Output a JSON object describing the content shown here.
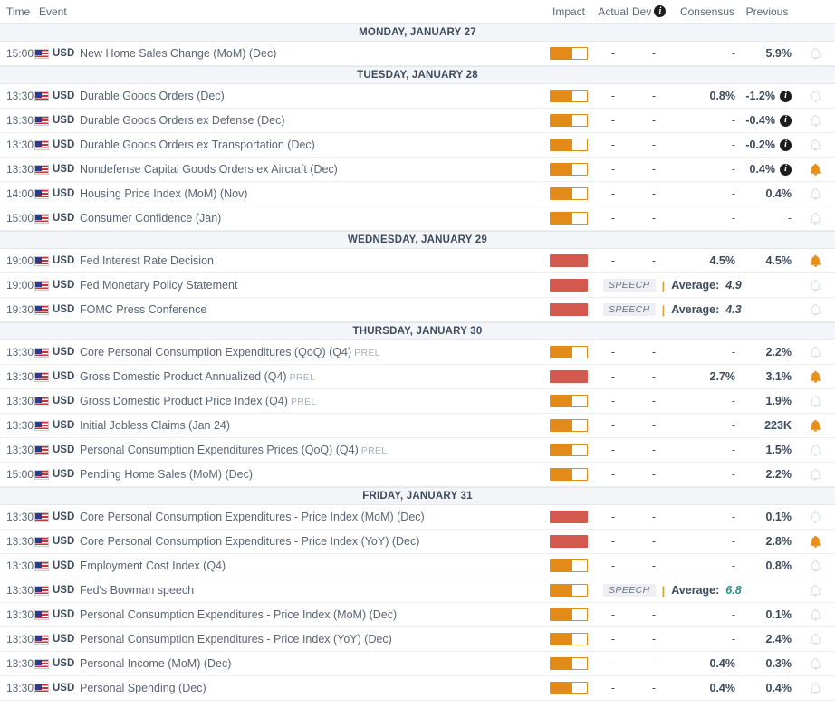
{
  "columns": {
    "time": "Time",
    "event": "Event",
    "impact": "Impact",
    "actual": "Actual",
    "dev": "Dev",
    "dev_info_icon": "info-icon",
    "consensus": "Consensus",
    "previous": "Previous"
  },
  "colors": {
    "impact_medium": "#e28b18",
    "impact_high": "#d3584e",
    "bell_active": "#e8901a",
    "bell_inactive": "#d8dce3",
    "day_header_bg": "#f4f5f8",
    "text": "#3d4a5c",
    "muted": "#5a6474",
    "tag": "#a8aeba",
    "speech_value_teal": "#2e8f86"
  },
  "days": [
    {
      "label": "MONDAY, JANUARY 27",
      "events": [
        {
          "time": "15:00",
          "currency": "USD",
          "flag": "us-flag-icon",
          "name": "New Home Sales Change (MoM) (Dec)",
          "tag": "",
          "impact": "medium",
          "actual": "-",
          "dev": "-",
          "consensus": "-",
          "consensus_bold": false,
          "previous": "5.9%",
          "previous_bold": true,
          "info": false,
          "bell": "inactive",
          "type": "data"
        }
      ]
    },
    {
      "label": "TUESDAY, JANUARY 28",
      "events": [
        {
          "time": "13:30",
          "currency": "USD",
          "flag": "us-flag-icon",
          "name": "Durable Goods Orders (Dec)",
          "tag": "",
          "impact": "medium",
          "actual": "-",
          "dev": "-",
          "consensus": "0.8%",
          "consensus_bold": true,
          "previous": "-1.2%",
          "previous_bold": true,
          "info": true,
          "bell": "inactive",
          "type": "data"
        },
        {
          "time": "13:30",
          "currency": "USD",
          "flag": "us-flag-icon",
          "name": "Durable Goods Orders ex Defense (Dec)",
          "tag": "",
          "impact": "medium",
          "actual": "-",
          "dev": "-",
          "consensus": "-",
          "consensus_bold": false,
          "previous": "-0.4%",
          "previous_bold": true,
          "info": true,
          "bell": "inactive",
          "type": "data"
        },
        {
          "time": "13:30",
          "currency": "USD",
          "flag": "us-flag-icon",
          "name": "Durable Goods Orders ex Transportation (Dec)",
          "tag": "",
          "impact": "medium",
          "actual": "-",
          "dev": "-",
          "consensus": "-",
          "consensus_bold": false,
          "previous": "-0.2%",
          "previous_bold": true,
          "info": true,
          "bell": "inactive",
          "type": "data"
        },
        {
          "time": "13:30",
          "currency": "USD",
          "flag": "us-flag-icon",
          "name": "Nondefense Capital Goods Orders ex Aircraft (Dec)",
          "tag": "",
          "impact": "medium",
          "actual": "-",
          "dev": "-",
          "consensus": "-",
          "consensus_bold": false,
          "previous": "0.4%",
          "previous_bold": true,
          "info": true,
          "bell": "active",
          "type": "data"
        },
        {
          "time": "14:00",
          "currency": "USD",
          "flag": "us-flag-icon",
          "name": "Housing Price Index (MoM) (Nov)",
          "tag": "",
          "impact": "medium",
          "actual": "-",
          "dev": "-",
          "consensus": "-",
          "consensus_bold": false,
          "previous": "0.4%",
          "previous_bold": true,
          "info": false,
          "bell": "inactive",
          "type": "data"
        },
        {
          "time": "15:00",
          "currency": "USD",
          "flag": "us-flag-icon",
          "name": "Consumer Confidence (Jan)",
          "tag": "",
          "impact": "medium",
          "actual": "-",
          "dev": "-",
          "consensus": "-",
          "consensus_bold": false,
          "previous": "-",
          "previous_bold": false,
          "info": false,
          "bell": "inactive",
          "type": "data"
        }
      ]
    },
    {
      "label": "WEDNESDAY, JANUARY 29",
      "events": [
        {
          "time": "19:00",
          "currency": "USD",
          "flag": "us-flag-icon",
          "name": "Fed Interest Rate Decision",
          "tag": "",
          "impact": "high",
          "actual": "-",
          "dev": "-",
          "consensus": "4.5%",
          "consensus_bold": true,
          "previous": "4.5%",
          "previous_bold": true,
          "info": false,
          "bell": "active",
          "type": "data"
        },
        {
          "time": "19:00",
          "currency": "USD",
          "flag": "us-flag-icon",
          "name": "Fed Monetary Policy Statement",
          "tag": "",
          "impact": "high",
          "speech_badge": "SPEECH",
          "speech_label": "Average:",
          "speech_value": "4.9",
          "speech_value_teal": false,
          "bell": "inactive",
          "type": "speech"
        },
        {
          "time": "19:30",
          "currency": "USD",
          "flag": "us-flag-icon",
          "name": "FOMC Press Conference",
          "tag": "",
          "impact": "high",
          "speech_badge": "SPEECH",
          "speech_label": "Average:",
          "speech_value": "4.3",
          "speech_value_teal": false,
          "bell": "inactive",
          "type": "speech"
        }
      ]
    },
    {
      "label": "THURSDAY, JANUARY 30",
      "events": [
        {
          "time": "13:30",
          "currency": "USD",
          "flag": "us-flag-icon",
          "name": "Core Personal Consumption Expenditures (QoQ) (Q4)",
          "tag": "PREL",
          "impact": "medium",
          "actual": "-",
          "dev": "-",
          "consensus": "-",
          "consensus_bold": false,
          "previous": "2.2%",
          "previous_bold": true,
          "info": false,
          "bell": "inactive",
          "type": "data"
        },
        {
          "time": "13:30",
          "currency": "USD",
          "flag": "us-flag-icon",
          "name": "Gross Domestic Product Annualized (Q4)",
          "tag": "PREL",
          "impact": "high",
          "actual": "-",
          "dev": "-",
          "consensus": "2.7%",
          "consensus_bold": true,
          "previous": "3.1%",
          "previous_bold": true,
          "info": false,
          "bell": "active",
          "type": "data"
        },
        {
          "time": "13:30",
          "currency": "USD",
          "flag": "us-flag-icon",
          "name": "Gross Domestic Product Price Index (Q4)",
          "tag": "PREL",
          "impact": "medium",
          "actual": "-",
          "dev": "-",
          "consensus": "-",
          "consensus_bold": false,
          "previous": "1.9%",
          "previous_bold": true,
          "info": false,
          "bell": "inactive",
          "type": "data"
        },
        {
          "time": "13:30",
          "currency": "USD",
          "flag": "us-flag-icon",
          "name": "Initial Jobless Claims (Jan 24)",
          "tag": "",
          "impact": "medium",
          "actual": "-",
          "dev": "-",
          "consensus": "-",
          "consensus_bold": false,
          "previous": "223K",
          "previous_bold": true,
          "info": false,
          "bell": "active",
          "type": "data"
        },
        {
          "time": "13:30",
          "currency": "USD",
          "flag": "us-flag-icon",
          "name": "Personal Consumption Expenditures Prices (QoQ) (Q4)",
          "tag": "PREL",
          "impact": "medium",
          "actual": "-",
          "dev": "-",
          "consensus": "-",
          "consensus_bold": false,
          "previous": "1.5%",
          "previous_bold": true,
          "info": false,
          "bell": "inactive",
          "type": "data"
        },
        {
          "time": "15:00",
          "currency": "USD",
          "flag": "us-flag-icon",
          "name": "Pending Home Sales (MoM) (Dec)",
          "tag": "",
          "impact": "medium",
          "actual": "-",
          "dev": "-",
          "consensus": "-",
          "consensus_bold": false,
          "previous": "2.2%",
          "previous_bold": true,
          "info": false,
          "bell": "inactive",
          "type": "data"
        }
      ]
    },
    {
      "label": "FRIDAY, JANUARY 31",
      "events": [
        {
          "time": "13:30",
          "currency": "USD",
          "flag": "us-flag-icon",
          "name": "Core Personal Consumption Expenditures - Price Index (MoM) (Dec)",
          "tag": "",
          "impact": "high",
          "actual": "-",
          "dev": "-",
          "consensus": "-",
          "consensus_bold": false,
          "previous": "0.1%",
          "previous_bold": true,
          "info": false,
          "bell": "inactive",
          "type": "data"
        },
        {
          "time": "13:30",
          "currency": "USD",
          "flag": "us-flag-icon",
          "name": "Core Personal Consumption Expenditures - Price Index (YoY) (Dec)",
          "tag": "",
          "impact": "high",
          "actual": "-",
          "dev": "-",
          "consensus": "-",
          "consensus_bold": false,
          "previous": "2.8%",
          "previous_bold": true,
          "info": false,
          "bell": "active",
          "type": "data"
        },
        {
          "time": "13:30",
          "currency": "USD",
          "flag": "us-flag-icon",
          "name": "Employment Cost Index (Q4)",
          "tag": "",
          "impact": "medium",
          "actual": "-",
          "dev": "-",
          "consensus": "-",
          "consensus_bold": false,
          "previous": "0.8%",
          "previous_bold": true,
          "info": false,
          "bell": "inactive",
          "type": "data"
        },
        {
          "time": "13:30",
          "currency": "USD",
          "flag": "us-flag-icon",
          "name": "Fed's Bowman speech",
          "tag": "",
          "impact": "medium",
          "speech_badge": "SPEECH",
          "speech_label": "Average:",
          "speech_value": "6.8",
          "speech_value_teal": true,
          "bell": "inactive",
          "type": "speech"
        },
        {
          "time": "13:30",
          "currency": "USD",
          "flag": "us-flag-icon",
          "name": "Personal Consumption Expenditures - Price Index (MoM) (Dec)",
          "tag": "",
          "impact": "medium",
          "actual": "-",
          "dev": "-",
          "consensus": "-",
          "consensus_bold": false,
          "previous": "0.1%",
          "previous_bold": true,
          "info": false,
          "bell": "inactive",
          "type": "data"
        },
        {
          "time": "13:30",
          "currency": "USD",
          "flag": "us-flag-icon",
          "name": "Personal Consumption Expenditures - Price Index (YoY) (Dec)",
          "tag": "",
          "impact": "medium",
          "actual": "-",
          "dev": "-",
          "consensus": "-",
          "consensus_bold": false,
          "previous": "2.4%",
          "previous_bold": true,
          "info": false,
          "bell": "inactive",
          "type": "data"
        },
        {
          "time": "13:30",
          "currency": "USD",
          "flag": "us-flag-icon",
          "name": "Personal Income (MoM) (Dec)",
          "tag": "",
          "impact": "medium",
          "actual": "-",
          "dev": "-",
          "consensus": "0.4%",
          "consensus_bold": true,
          "previous": "0.3%",
          "previous_bold": true,
          "info": false,
          "bell": "inactive",
          "type": "data"
        },
        {
          "time": "13:30",
          "currency": "USD",
          "flag": "us-flag-icon",
          "name": "Personal Spending (Dec)",
          "tag": "",
          "impact": "medium",
          "actual": "-",
          "dev": "-",
          "consensus": "0.4%",
          "consensus_bold": true,
          "previous": "0.4%",
          "previous_bold": true,
          "info": false,
          "bell": "inactive",
          "type": "data"
        }
      ]
    }
  ]
}
